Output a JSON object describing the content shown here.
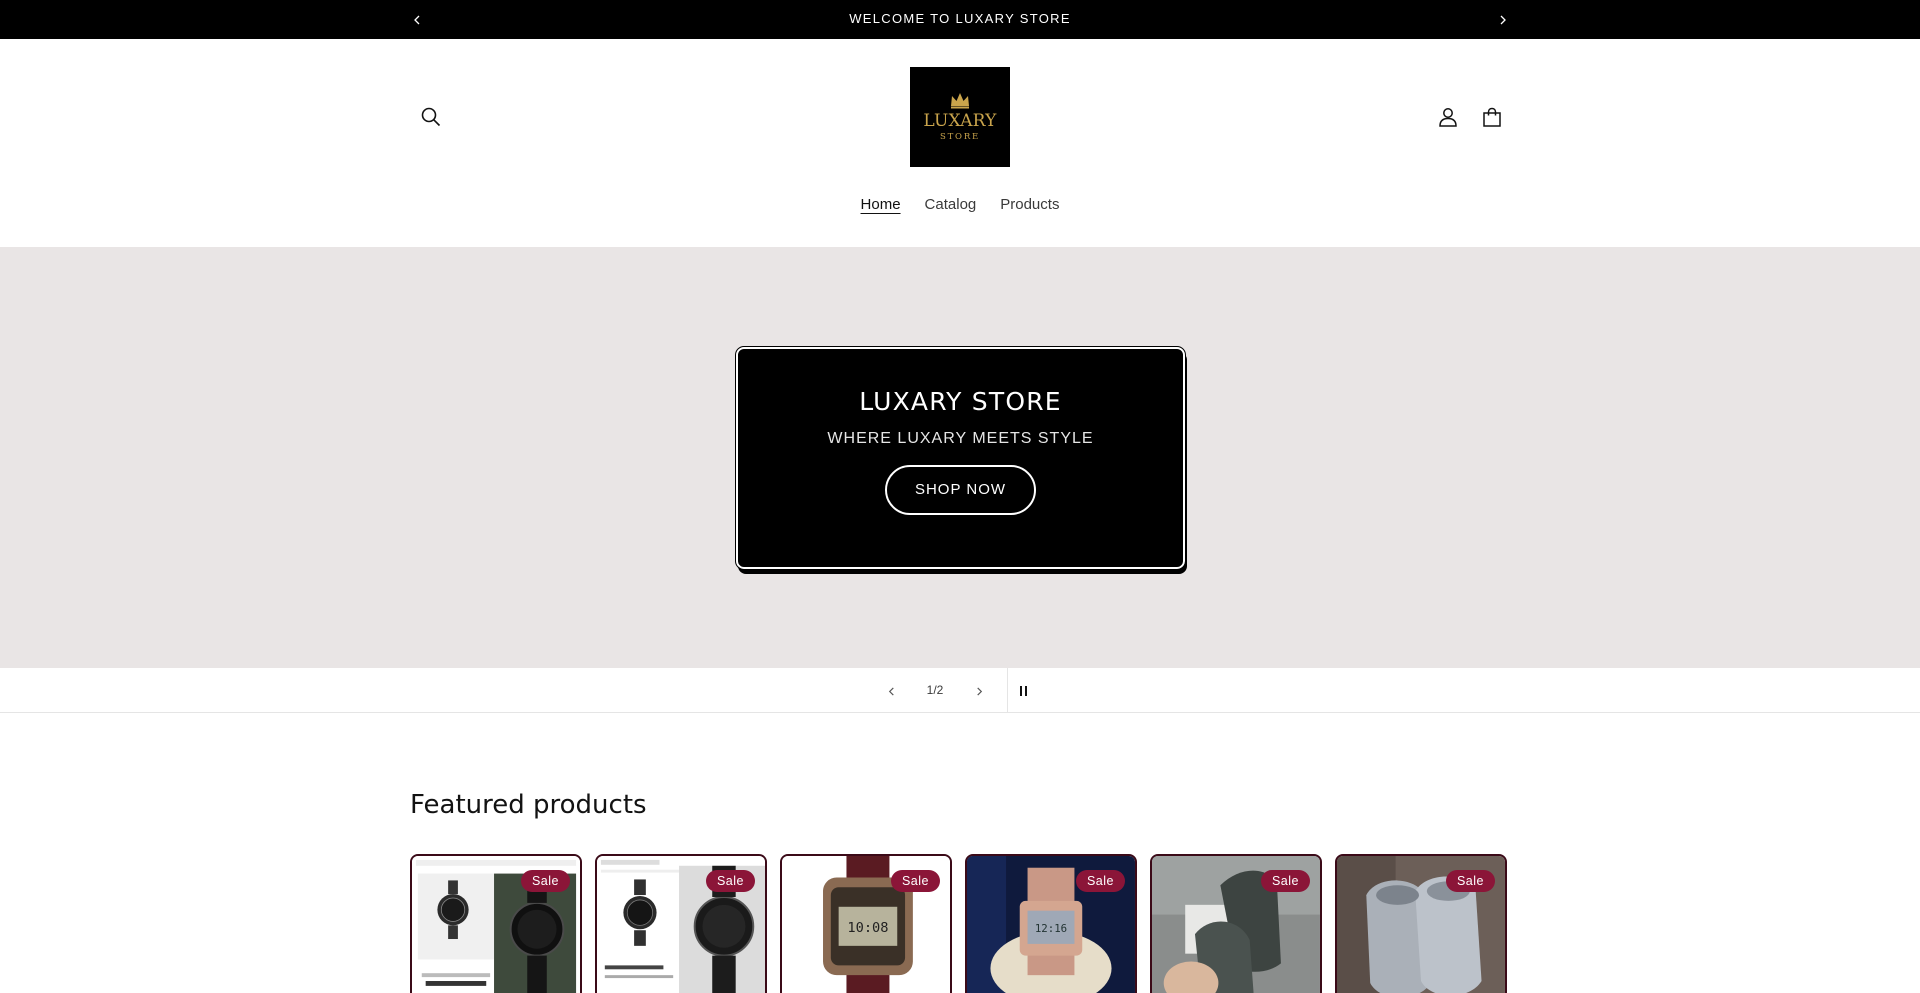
{
  "announcement": {
    "text": "WELCOME TO LUXARY STORE"
  },
  "logo": {
    "main": "LUXARY",
    "sub": "STORE"
  },
  "nav": {
    "items": [
      "Home",
      "Catalog",
      "Products"
    ]
  },
  "hero": {
    "title": "LUXARY STORE",
    "subtitle": "WHERE LUXARY MEETS STYLE",
    "button": "SHOP NOW"
  },
  "slideshow": {
    "counter": "1/2"
  },
  "featured": {
    "title": "Featured products",
    "badge": "Sale",
    "products": [
      {
        "image": "armani-exchange-watches-screenshot-image",
        "badge": "Sale"
      },
      {
        "image": "armani-exchange-black-chronograph-image",
        "badge": "Sale"
      },
      {
        "image": "casio-digital-vintage-watch-image",
        "badge": "Sale"
      },
      {
        "image": "rose-gold-digital-watch-image",
        "badge": "Sale"
      },
      {
        "image": "gray-clog-shoes-in-hand-image",
        "badge": "Sale"
      },
      {
        "image": "gray-clog-shoes-pair-image",
        "badge": "Sale"
      }
    ]
  },
  "colors": {
    "announcement_bg": "#000000",
    "hero_bg": "#e9e5e5",
    "sale_badge": "#8b1538",
    "logo_gold": "#c9a44c"
  }
}
